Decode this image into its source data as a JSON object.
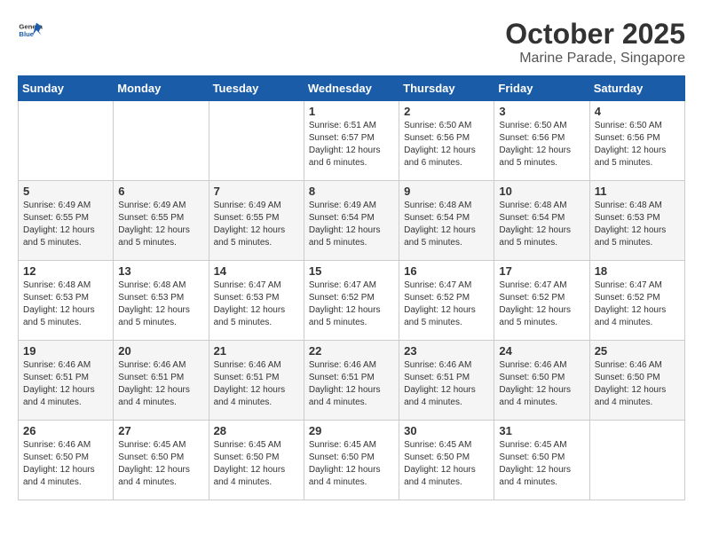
{
  "header": {
    "logo_general": "General",
    "logo_blue": "Blue",
    "month": "October 2025",
    "location": "Marine Parade, Singapore"
  },
  "weekdays": [
    "Sunday",
    "Monday",
    "Tuesday",
    "Wednesday",
    "Thursday",
    "Friday",
    "Saturday"
  ],
  "weeks": [
    [
      {
        "day": "",
        "info": ""
      },
      {
        "day": "",
        "info": ""
      },
      {
        "day": "",
        "info": ""
      },
      {
        "day": "1",
        "info": "Sunrise: 6:51 AM\nSunset: 6:57 PM\nDaylight: 12 hours\nand 6 minutes."
      },
      {
        "day": "2",
        "info": "Sunrise: 6:50 AM\nSunset: 6:56 PM\nDaylight: 12 hours\nand 6 minutes."
      },
      {
        "day": "3",
        "info": "Sunrise: 6:50 AM\nSunset: 6:56 PM\nDaylight: 12 hours\nand 5 minutes."
      },
      {
        "day": "4",
        "info": "Sunrise: 6:50 AM\nSunset: 6:56 PM\nDaylight: 12 hours\nand 5 minutes."
      }
    ],
    [
      {
        "day": "5",
        "info": "Sunrise: 6:49 AM\nSunset: 6:55 PM\nDaylight: 12 hours\nand 5 minutes."
      },
      {
        "day": "6",
        "info": "Sunrise: 6:49 AM\nSunset: 6:55 PM\nDaylight: 12 hours\nand 5 minutes."
      },
      {
        "day": "7",
        "info": "Sunrise: 6:49 AM\nSunset: 6:55 PM\nDaylight: 12 hours\nand 5 minutes."
      },
      {
        "day": "8",
        "info": "Sunrise: 6:49 AM\nSunset: 6:54 PM\nDaylight: 12 hours\nand 5 minutes."
      },
      {
        "day": "9",
        "info": "Sunrise: 6:48 AM\nSunset: 6:54 PM\nDaylight: 12 hours\nand 5 minutes."
      },
      {
        "day": "10",
        "info": "Sunrise: 6:48 AM\nSunset: 6:54 PM\nDaylight: 12 hours\nand 5 minutes."
      },
      {
        "day": "11",
        "info": "Sunrise: 6:48 AM\nSunset: 6:53 PM\nDaylight: 12 hours\nand 5 minutes."
      }
    ],
    [
      {
        "day": "12",
        "info": "Sunrise: 6:48 AM\nSunset: 6:53 PM\nDaylight: 12 hours\nand 5 minutes."
      },
      {
        "day": "13",
        "info": "Sunrise: 6:48 AM\nSunset: 6:53 PM\nDaylight: 12 hours\nand 5 minutes."
      },
      {
        "day": "14",
        "info": "Sunrise: 6:47 AM\nSunset: 6:53 PM\nDaylight: 12 hours\nand 5 minutes."
      },
      {
        "day": "15",
        "info": "Sunrise: 6:47 AM\nSunset: 6:52 PM\nDaylight: 12 hours\nand 5 minutes."
      },
      {
        "day": "16",
        "info": "Sunrise: 6:47 AM\nSunset: 6:52 PM\nDaylight: 12 hours\nand 5 minutes."
      },
      {
        "day": "17",
        "info": "Sunrise: 6:47 AM\nSunset: 6:52 PM\nDaylight: 12 hours\nand 5 minutes."
      },
      {
        "day": "18",
        "info": "Sunrise: 6:47 AM\nSunset: 6:52 PM\nDaylight: 12 hours\nand 4 minutes."
      }
    ],
    [
      {
        "day": "19",
        "info": "Sunrise: 6:46 AM\nSunset: 6:51 PM\nDaylight: 12 hours\nand 4 minutes."
      },
      {
        "day": "20",
        "info": "Sunrise: 6:46 AM\nSunset: 6:51 PM\nDaylight: 12 hours\nand 4 minutes."
      },
      {
        "day": "21",
        "info": "Sunrise: 6:46 AM\nSunset: 6:51 PM\nDaylight: 12 hours\nand 4 minutes."
      },
      {
        "day": "22",
        "info": "Sunrise: 6:46 AM\nSunset: 6:51 PM\nDaylight: 12 hours\nand 4 minutes."
      },
      {
        "day": "23",
        "info": "Sunrise: 6:46 AM\nSunset: 6:51 PM\nDaylight: 12 hours\nand 4 minutes."
      },
      {
        "day": "24",
        "info": "Sunrise: 6:46 AM\nSunset: 6:50 PM\nDaylight: 12 hours\nand 4 minutes."
      },
      {
        "day": "25",
        "info": "Sunrise: 6:46 AM\nSunset: 6:50 PM\nDaylight: 12 hours\nand 4 minutes."
      }
    ],
    [
      {
        "day": "26",
        "info": "Sunrise: 6:46 AM\nSunset: 6:50 PM\nDaylight: 12 hours\nand 4 minutes."
      },
      {
        "day": "27",
        "info": "Sunrise: 6:45 AM\nSunset: 6:50 PM\nDaylight: 12 hours\nand 4 minutes."
      },
      {
        "day": "28",
        "info": "Sunrise: 6:45 AM\nSunset: 6:50 PM\nDaylight: 12 hours\nand 4 minutes."
      },
      {
        "day": "29",
        "info": "Sunrise: 6:45 AM\nSunset: 6:50 PM\nDaylight: 12 hours\nand 4 minutes."
      },
      {
        "day": "30",
        "info": "Sunrise: 6:45 AM\nSunset: 6:50 PM\nDaylight: 12 hours\nand 4 minutes."
      },
      {
        "day": "31",
        "info": "Sunrise: 6:45 AM\nSunset: 6:50 PM\nDaylight: 12 hours\nand 4 minutes."
      },
      {
        "day": "",
        "info": ""
      }
    ]
  ]
}
